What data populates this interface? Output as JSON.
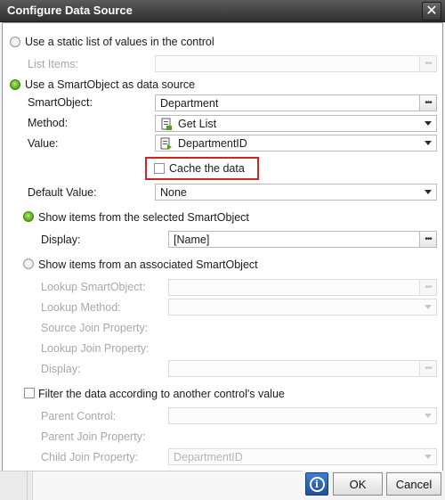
{
  "dialog": {
    "title": "Configure Data Source",
    "close_icon": "close-icon"
  },
  "source": {
    "static_label": "Use a static list of values in the control",
    "list_items_label": "List Items:",
    "list_items_value": "",
    "smartobject_label": "Use a SmartObject as data source",
    "smartobject_field_label": "SmartObject:",
    "smartobject_value": "Department",
    "method_label": "Method:",
    "method_value": "Get List",
    "method_icon": "method-icon",
    "value_label": "Value:",
    "value_value": "DepartmentID",
    "value_icon": "property-icon",
    "cache_label": "Cache the data",
    "cache_checked": false,
    "default_value_label": "Default Value:",
    "default_value_value": "None"
  },
  "show_selected": {
    "label": "Show items from the selected SmartObject",
    "display_label": "Display:",
    "display_value": "[Name]"
  },
  "show_associated": {
    "label": "Show items from an associated SmartObject",
    "lookup_smartobject_label": "Lookup SmartObject:",
    "lookup_method_label": "Lookup Method:",
    "source_join_label": "Source Join Property:",
    "lookup_join_label": "Lookup Join Property:",
    "display_label": "Display:"
  },
  "filter": {
    "label": "Filter the data according to another control's value",
    "parent_control_label": "Parent Control:",
    "parent_join_label": "Parent Join Property:",
    "child_join_label": "Child Join Property:",
    "child_join_value": "DepartmentID"
  },
  "footer": {
    "info_icon": "info-icon",
    "ok_label": "OK",
    "cancel_label": "Cancel"
  },
  "colors": {
    "title_bar": "#3f3f3f",
    "radio_selected": "#6dbf2b",
    "highlight_border": "#d42121",
    "info_button": "#2a62b8"
  }
}
